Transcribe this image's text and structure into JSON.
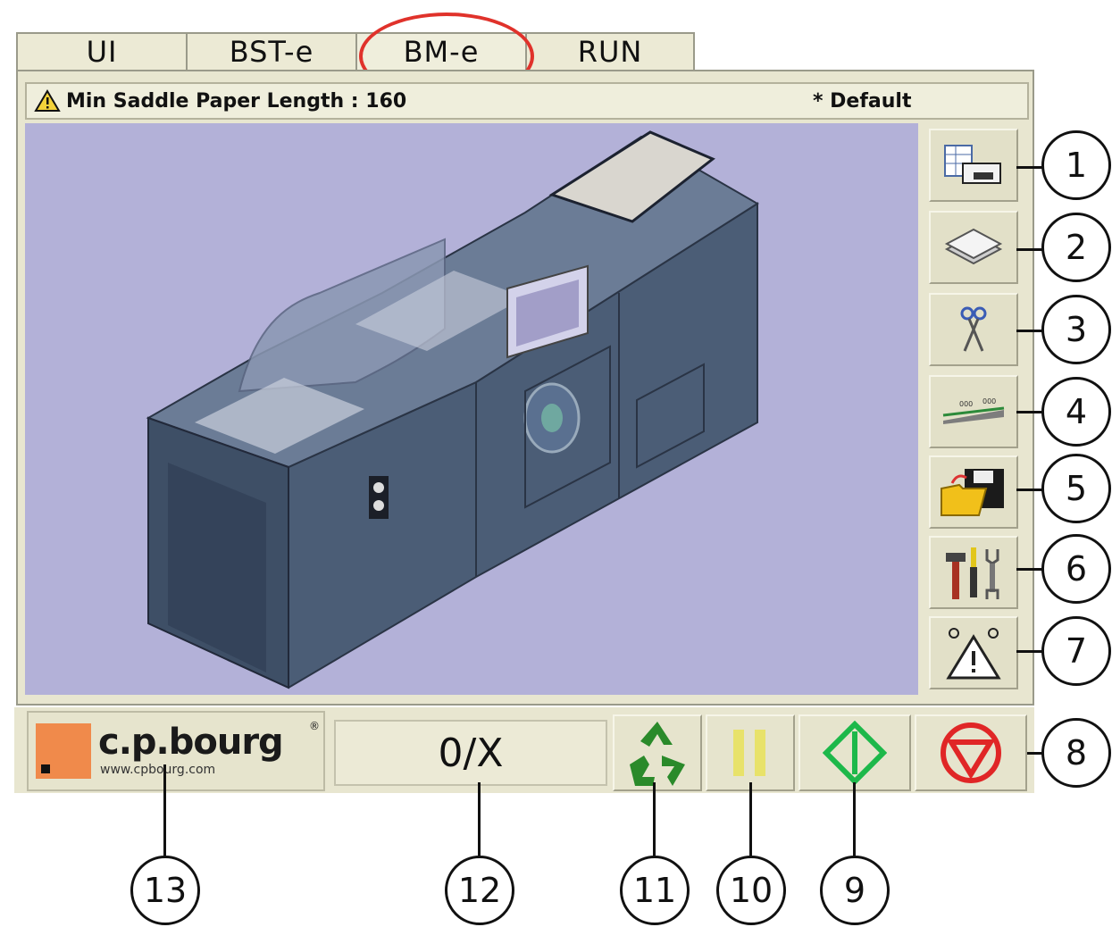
{
  "tabs": [
    {
      "label": "UI"
    },
    {
      "label": "BST-e"
    },
    {
      "label": "BM-e"
    },
    {
      "label": "RUN"
    }
  ],
  "status": {
    "message": "Min Saddle Paper Length : 160",
    "preset": "* Default"
  },
  "side_buttons": [
    {
      "icon": "layout-icon"
    },
    {
      "icon": "paper-stack-icon"
    },
    {
      "icon": "scissors-icon"
    },
    {
      "icon": "ruler-icon"
    },
    {
      "icon": "floppy-folder-icon"
    },
    {
      "icon": "tools-icon"
    },
    {
      "icon": "warning-sensors-icon"
    }
  ],
  "logo": {
    "brand": "c.p.bourg",
    "reg": "®",
    "url": "www.cpbourg.com",
    "accent_color": "#f08a4b"
  },
  "counter": {
    "value": "0/X"
  },
  "controls": [
    {
      "icon": "recycle-icon",
      "color": "#2a8a2a"
    },
    {
      "icon": "pause-icon",
      "color": "#e8e26a"
    },
    {
      "icon": "start-icon",
      "color": "#1db84a"
    },
    {
      "icon": "stop-icon",
      "color": "#e02626"
    }
  ],
  "callouts": [
    "1",
    "2",
    "3",
    "4",
    "5",
    "6",
    "7",
    "8",
    "9",
    "10",
    "11",
    "12",
    "13"
  ]
}
